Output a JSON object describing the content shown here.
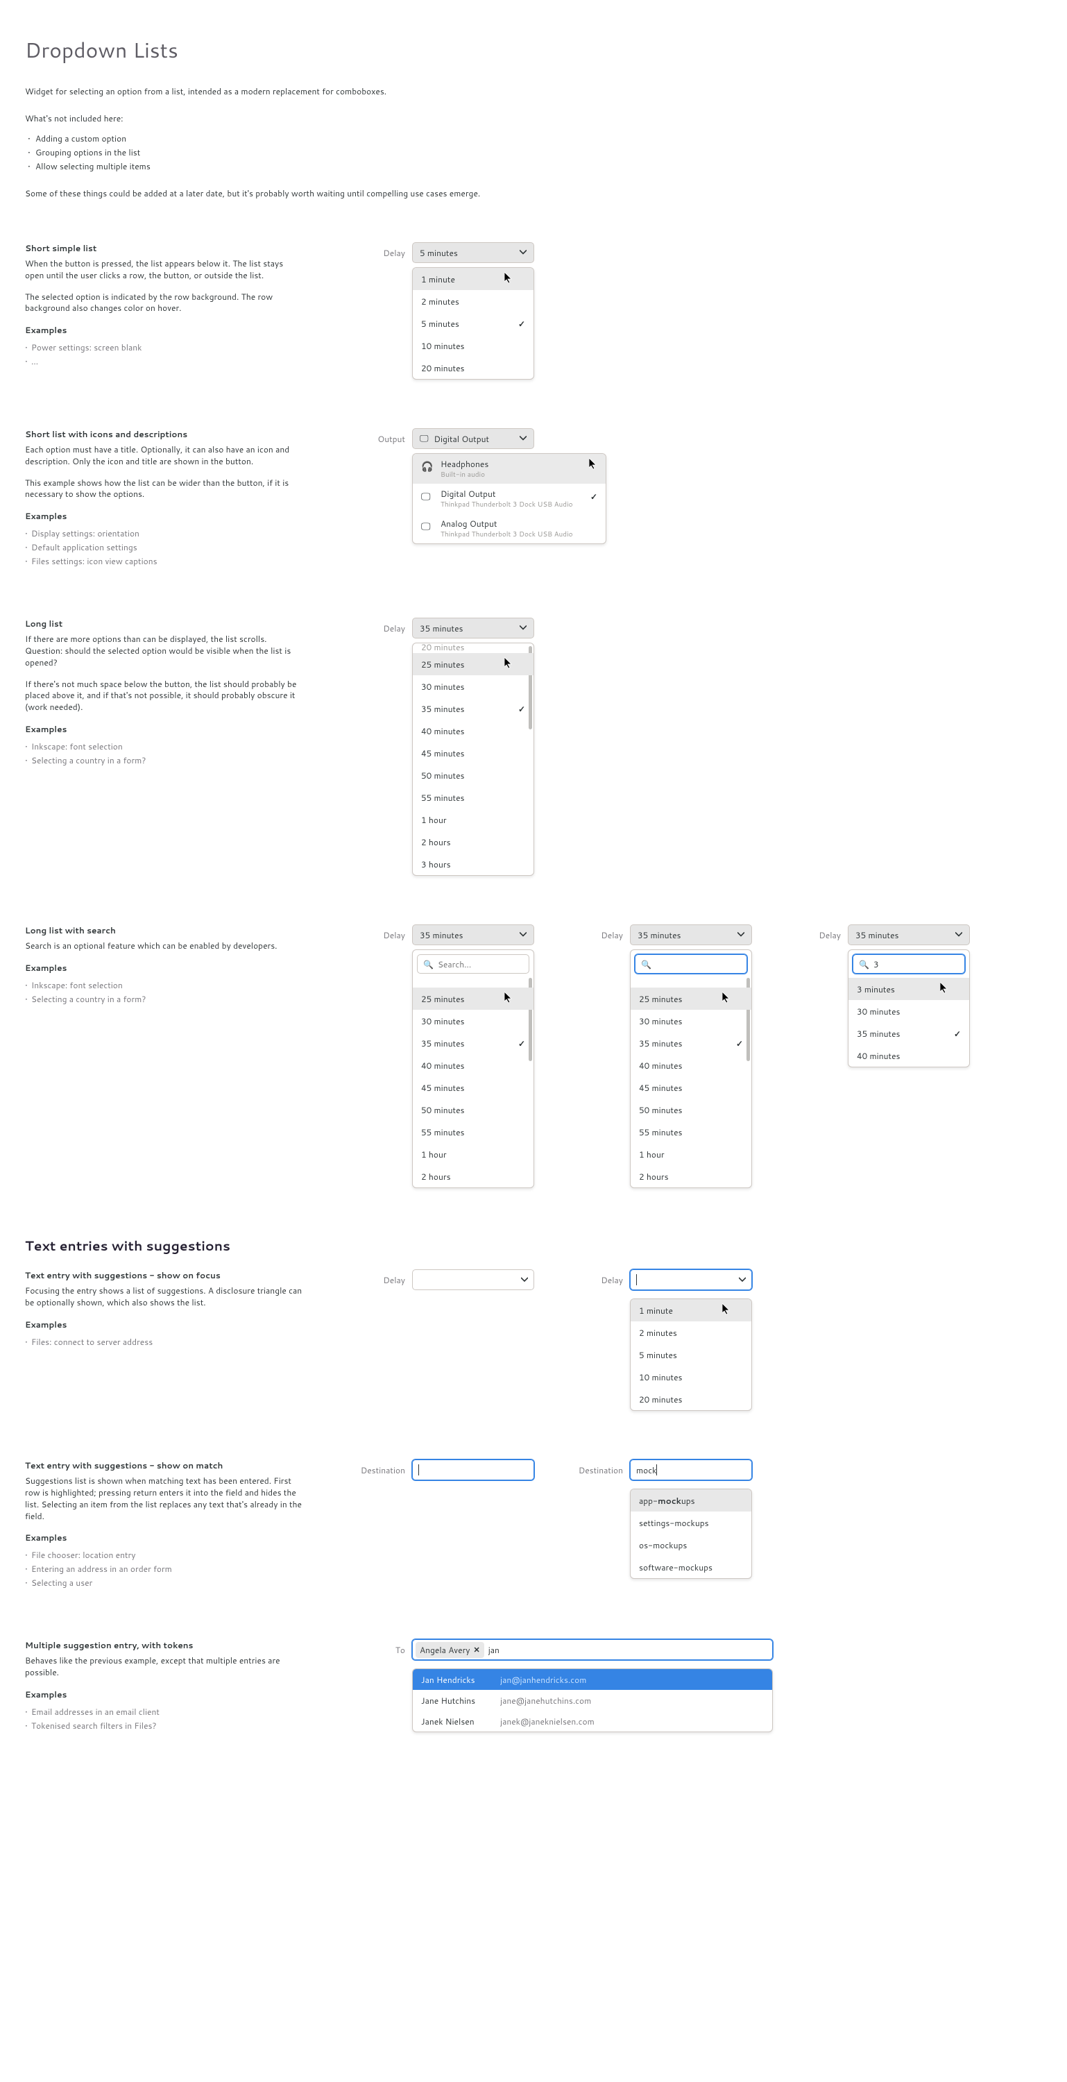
{
  "page_title": "Dropdown Lists",
  "intro": "Widget for selecting an option from a list, intended as a modern replacement for comboboxes.",
  "not_included_heading": "What's not included here:",
  "not_included": [
    "Adding a custom option",
    "Grouping options in the list",
    "Allow selecting multiple items"
  ],
  "note": "Some of these things could be added at a later date, but it's probably worth waiting until  compelling use cases emerge.",
  "s1": {
    "title": "Short simple list",
    "p1": "When the button is pressed, the list appears below it. The list stays open until the user clicks a row, the button, or outside the list.",
    "p2": "The selected option is indicated by the row background. The row background also changes color on hover.",
    "ex_h": "Examples",
    "ex": [
      "Power settings: screen blank",
      "..."
    ],
    "label": "Delay",
    "btn": "5 minutes",
    "items": [
      "1 minute",
      "2 minutes",
      "5 minutes",
      "10 minutes",
      "20 minutes"
    ],
    "selected": "5 minutes",
    "hover": "1 minute"
  },
  "s2": {
    "title": "Short list with icons and descriptions",
    "p1": "Each option must have a title. Optionally, it can also have an icon and description. Only the icon and title are shown in the button.",
    "p2": "This example shows how the list can be wider than the button, if it is necessary to show the options.",
    "ex_h": "Examples",
    "ex": [
      "Display settings: orientation",
      "Default application settings",
      "Files settings: icon view captions"
    ],
    "label": "Output",
    "btn": "Digital Output",
    "items": [
      {
        "icon": "🎧",
        "title": "Headphones",
        "sub": "Built-in audio"
      },
      {
        "icon": "🖵",
        "title": "Digital Output",
        "sub": "Thinkpad Thunderbolt 3 Dock USB Audio"
      },
      {
        "icon": "🖵",
        "title": "Analog Output",
        "sub": "Thinkpad Thunderbolt 3 Dock USB Audio"
      }
    ],
    "selected": "Digital Output",
    "hover": "Headphones"
  },
  "s3": {
    "title": "Long list",
    "p1": "If there are more options than can be displayed, the list scrolls. Question: should the selected option would be visible when the list is opened?",
    "p2": "If there's not much space below the button, the list should probably be placed above it, and if that's not possible, it should probably obscure it (work needed).",
    "ex_h": "Examples",
    "ex": [
      "Inkscape: font selection",
      "Selecting a country in a form?"
    ],
    "label": "Delay",
    "btn": "35 minutes",
    "partial_top": "20 minutes",
    "items": [
      "25 minutes",
      "30 minutes",
      "35 minutes",
      "40 minutes",
      "45 minutes",
      "50 minutes",
      "55 minutes",
      "1 hour",
      "2 hours",
      "3 hours"
    ],
    "selected": "35 minutes",
    "hover": "25 minutes"
  },
  "s4": {
    "title": "Long list with search",
    "p1": "Search is an optional feature which can be enabled by developers.",
    "ex_h": "Examples",
    "ex": [
      "Inkscape: font selection",
      "Selecting a country in a form?"
    ],
    "label": "Delay",
    "btn": "35 minutes",
    "search_placeholder": "Search...",
    "col1_items": [
      "25 minutes",
      "30 minutes",
      "35 minutes",
      "40 minutes",
      "45 minutes",
      "50 minutes",
      "55 minutes",
      "1 hour",
      "2 hours"
    ],
    "col3_query": "3",
    "col3_items": [
      "3 minutes",
      "30 minutes",
      "35 minutes",
      "40 minutes"
    ],
    "selected": "35 minutes",
    "hover": "25 minutes"
  },
  "h2": "Text entries with suggestions",
  "s5": {
    "title": "Text entry with suggestions - show on focus",
    "p1": "Focusing the entry shows a list of suggestions. A disclosure triangle can be optionally shown, which also shows the list.",
    "ex_h": "Examples",
    "ex": [
      "Files: connect to server address"
    ],
    "label": "Delay",
    "items": [
      "1 minute",
      "2 minutes",
      "5 minutes",
      "10 minutes",
      "20 minutes"
    ],
    "hover": "1 minute"
  },
  "s6": {
    "title": "Text entry with suggestions - show on match",
    "p1": "Suggestions list is shown when matching text has been entered. First row is highlighted; pressing return enters it into the field and hides the list. Selecting an item from the list replaces any text that's already in the field.",
    "ex_h": "Examples",
    "ex": [
      "File chooser: location entry",
      "Entering an address in an order form",
      "Selecting a user"
    ],
    "label": "Destination",
    "typed": "mock",
    "items": [
      {
        "pre": "app-",
        "match": "mock",
        "post": "ups"
      },
      {
        "pre": "settings-",
        "match": "mock",
        "post": "ups"
      },
      {
        "pre": "os-",
        "match": "mock",
        "post": "ups"
      },
      {
        "pre": "software-",
        "match": "mock",
        "post": "ups"
      }
    ]
  },
  "s7": {
    "title": "Multiple suggestion entry, with tokens",
    "p1": "Behaves like the previous example, except that multiple entries are possible.",
    "ex_h": "Examples",
    "ex": [
      "Email addresses in an email client",
      "Tokenised search filters in Files?"
    ],
    "label": "To",
    "token": "Angela Avery",
    "typed": "jan",
    "items": [
      {
        "name": "Jan Hendricks",
        "email": "jan@janhendricks.com"
      },
      {
        "name": "Jane Hutchins",
        "email": "jane@janehutchins.com"
      },
      {
        "name": "Janek Nielsen",
        "email": "janek@janeknielsen.com"
      }
    ]
  }
}
